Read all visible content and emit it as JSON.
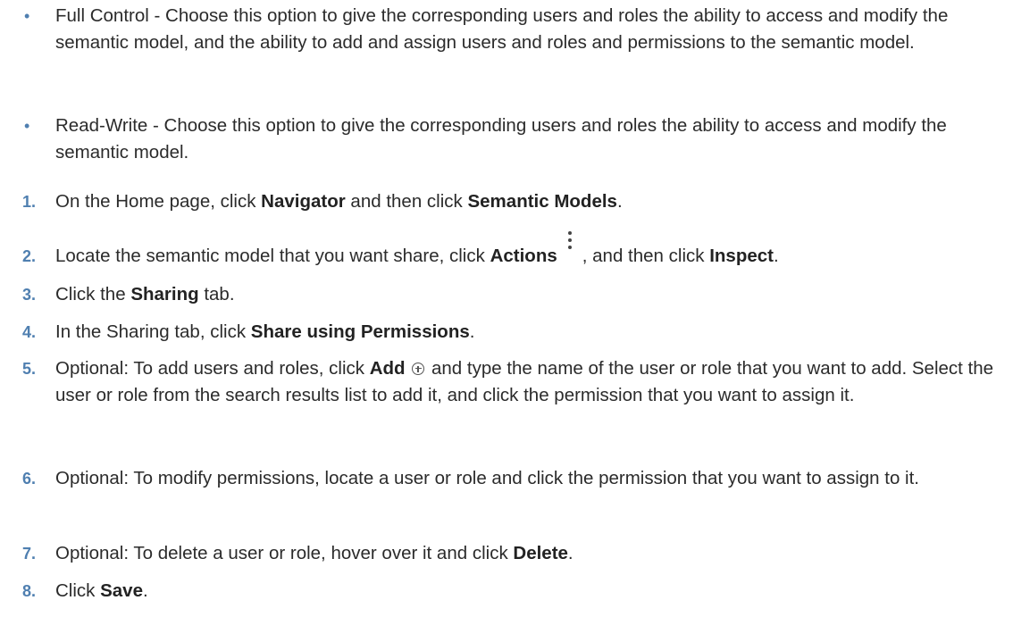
{
  "bullets": [
    {
      "marker": "•",
      "text": "Full Control - Choose this option to give the corresponding users and roles the ability to access and modify the semantic model, and the ability to add and assign users and roles and permissions to the semantic model."
    },
    {
      "marker": "•",
      "text": "Read-Write - Choose this option to give the corresponding users and roles the ability to access and modify the semantic model."
    }
  ],
  "steps": [
    {
      "number": "1.",
      "t1": "On the Home page, click ",
      "b1": "Navigator",
      "t2": " and then click ",
      "b2": "Semantic Models",
      "t3": "."
    },
    {
      "number": "2.",
      "t1": "Locate the semantic model that you want share, click ",
      "b1": "Actions",
      "icon": "kebab-menu-icon",
      "t2": ", and then click ",
      "b2": "Inspect",
      "t3": "."
    },
    {
      "number": "3.",
      "t1": "Click the ",
      "b1": "Sharing",
      "t2": " tab."
    },
    {
      "number": "4.",
      "t1": "In the Sharing tab, click ",
      "b1": "Share using Permissions",
      "t2": "."
    },
    {
      "number": "5.",
      "t1": "Optional: To add users and roles, click ",
      "b1": "Add",
      "icon": "add-circle-icon",
      "t2": " and type the name of the user or role that you want to add. Select the user or role from the search results list to add it, and click the permission that you want to assign it."
    },
    {
      "number": "6.",
      "t1": "Optional: To modify permissions, locate a user or role and click the permission that you want to assign to it."
    },
    {
      "number": "7.",
      "t1": "Optional: To delete a user or role, hover over it and click ",
      "b1": "Delete",
      "t2": "."
    },
    {
      "number": "8.",
      "t1": "Click ",
      "b1": "Save",
      "t2": "."
    }
  ]
}
